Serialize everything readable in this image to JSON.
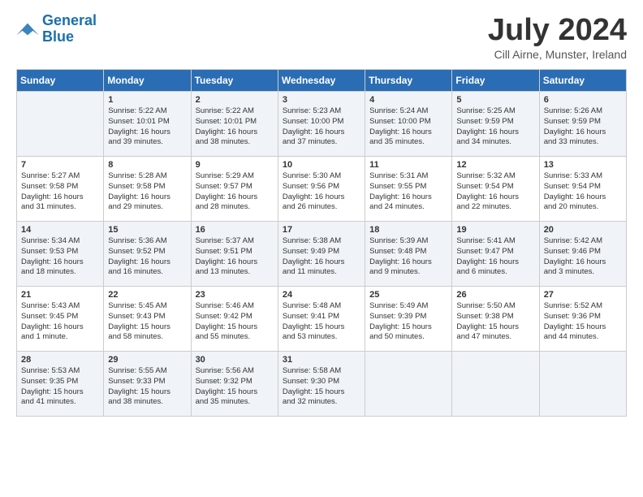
{
  "logo": {
    "line1": "General",
    "line2": "Blue"
  },
  "title": "July 2024",
  "location": "Cill Airne, Munster, Ireland",
  "headers": [
    "Sunday",
    "Monday",
    "Tuesday",
    "Wednesday",
    "Thursday",
    "Friday",
    "Saturday"
  ],
  "weeks": [
    [
      {
        "day": "",
        "content": ""
      },
      {
        "day": "1",
        "content": "Sunrise: 5:22 AM\nSunset: 10:01 PM\nDaylight: 16 hours\nand 39 minutes."
      },
      {
        "day": "2",
        "content": "Sunrise: 5:22 AM\nSunset: 10:01 PM\nDaylight: 16 hours\nand 38 minutes."
      },
      {
        "day": "3",
        "content": "Sunrise: 5:23 AM\nSunset: 10:00 PM\nDaylight: 16 hours\nand 37 minutes."
      },
      {
        "day": "4",
        "content": "Sunrise: 5:24 AM\nSunset: 10:00 PM\nDaylight: 16 hours\nand 35 minutes."
      },
      {
        "day": "5",
        "content": "Sunrise: 5:25 AM\nSunset: 9:59 PM\nDaylight: 16 hours\nand 34 minutes."
      },
      {
        "day": "6",
        "content": "Sunrise: 5:26 AM\nSunset: 9:59 PM\nDaylight: 16 hours\nand 33 minutes."
      }
    ],
    [
      {
        "day": "7",
        "content": "Sunrise: 5:27 AM\nSunset: 9:58 PM\nDaylight: 16 hours\nand 31 minutes."
      },
      {
        "day": "8",
        "content": "Sunrise: 5:28 AM\nSunset: 9:58 PM\nDaylight: 16 hours\nand 29 minutes."
      },
      {
        "day": "9",
        "content": "Sunrise: 5:29 AM\nSunset: 9:57 PM\nDaylight: 16 hours\nand 28 minutes."
      },
      {
        "day": "10",
        "content": "Sunrise: 5:30 AM\nSunset: 9:56 PM\nDaylight: 16 hours\nand 26 minutes."
      },
      {
        "day": "11",
        "content": "Sunrise: 5:31 AM\nSunset: 9:55 PM\nDaylight: 16 hours\nand 24 minutes."
      },
      {
        "day": "12",
        "content": "Sunrise: 5:32 AM\nSunset: 9:54 PM\nDaylight: 16 hours\nand 22 minutes."
      },
      {
        "day": "13",
        "content": "Sunrise: 5:33 AM\nSunset: 9:54 PM\nDaylight: 16 hours\nand 20 minutes."
      }
    ],
    [
      {
        "day": "14",
        "content": "Sunrise: 5:34 AM\nSunset: 9:53 PM\nDaylight: 16 hours\nand 18 minutes."
      },
      {
        "day": "15",
        "content": "Sunrise: 5:36 AM\nSunset: 9:52 PM\nDaylight: 16 hours\nand 16 minutes."
      },
      {
        "day": "16",
        "content": "Sunrise: 5:37 AM\nSunset: 9:51 PM\nDaylight: 16 hours\nand 13 minutes."
      },
      {
        "day": "17",
        "content": "Sunrise: 5:38 AM\nSunset: 9:49 PM\nDaylight: 16 hours\nand 11 minutes."
      },
      {
        "day": "18",
        "content": "Sunrise: 5:39 AM\nSunset: 9:48 PM\nDaylight: 16 hours\nand 9 minutes."
      },
      {
        "day": "19",
        "content": "Sunrise: 5:41 AM\nSunset: 9:47 PM\nDaylight: 16 hours\nand 6 minutes."
      },
      {
        "day": "20",
        "content": "Sunrise: 5:42 AM\nSunset: 9:46 PM\nDaylight: 16 hours\nand 3 minutes."
      }
    ],
    [
      {
        "day": "21",
        "content": "Sunrise: 5:43 AM\nSunset: 9:45 PM\nDaylight: 16 hours\nand 1 minute."
      },
      {
        "day": "22",
        "content": "Sunrise: 5:45 AM\nSunset: 9:43 PM\nDaylight: 15 hours\nand 58 minutes."
      },
      {
        "day": "23",
        "content": "Sunrise: 5:46 AM\nSunset: 9:42 PM\nDaylight: 15 hours\nand 55 minutes."
      },
      {
        "day": "24",
        "content": "Sunrise: 5:48 AM\nSunset: 9:41 PM\nDaylight: 15 hours\nand 53 minutes."
      },
      {
        "day": "25",
        "content": "Sunrise: 5:49 AM\nSunset: 9:39 PM\nDaylight: 15 hours\nand 50 minutes."
      },
      {
        "day": "26",
        "content": "Sunrise: 5:50 AM\nSunset: 9:38 PM\nDaylight: 15 hours\nand 47 minutes."
      },
      {
        "day": "27",
        "content": "Sunrise: 5:52 AM\nSunset: 9:36 PM\nDaylight: 15 hours\nand 44 minutes."
      }
    ],
    [
      {
        "day": "28",
        "content": "Sunrise: 5:53 AM\nSunset: 9:35 PM\nDaylight: 15 hours\nand 41 minutes."
      },
      {
        "day": "29",
        "content": "Sunrise: 5:55 AM\nSunset: 9:33 PM\nDaylight: 15 hours\nand 38 minutes."
      },
      {
        "day": "30",
        "content": "Sunrise: 5:56 AM\nSunset: 9:32 PM\nDaylight: 15 hours\nand 35 minutes."
      },
      {
        "day": "31",
        "content": "Sunrise: 5:58 AM\nSunset: 9:30 PM\nDaylight: 15 hours\nand 32 minutes."
      },
      {
        "day": "",
        "content": ""
      },
      {
        "day": "",
        "content": ""
      },
      {
        "day": "",
        "content": ""
      }
    ]
  ]
}
